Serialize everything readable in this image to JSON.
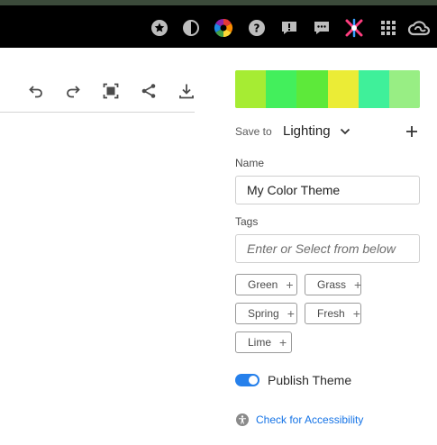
{
  "topbar": {
    "icons": [
      "star-badge-icon",
      "contrast-icon",
      "color-wheel-icon",
      "help-icon",
      "alert-icon",
      "chat-icon",
      "creative-apps-icon",
      "app-grid-icon",
      "creative-cloud-icon"
    ]
  },
  "toolbar": {
    "icons": [
      "undo-icon",
      "redo-icon",
      "fit-screen-icon",
      "share-icon",
      "download-icon"
    ]
  },
  "swatches": [
    "#a6ec33",
    "#43ef5c",
    "#5de93a",
    "#ebec36",
    "#3ff09a",
    "#98ee84"
  ],
  "save_to": {
    "label": "Save to",
    "value": "Lighting"
  },
  "name_field": {
    "label": "Name",
    "value": "My Color Theme"
  },
  "tags_field": {
    "label": "Tags",
    "placeholder": "Enter or Select from below"
  },
  "tags": [
    {
      "label": "Green"
    },
    {
      "label": "Grass"
    },
    {
      "label": "Spring"
    },
    {
      "label": "Fresh"
    },
    {
      "label": "Lime"
    }
  ],
  "publish": {
    "label": "Publish Theme",
    "on": true
  },
  "accessibility": {
    "link_text": "Check for Accessibility"
  },
  "colors": {
    "accent": "#2680eb",
    "link": "#1473e6"
  }
}
